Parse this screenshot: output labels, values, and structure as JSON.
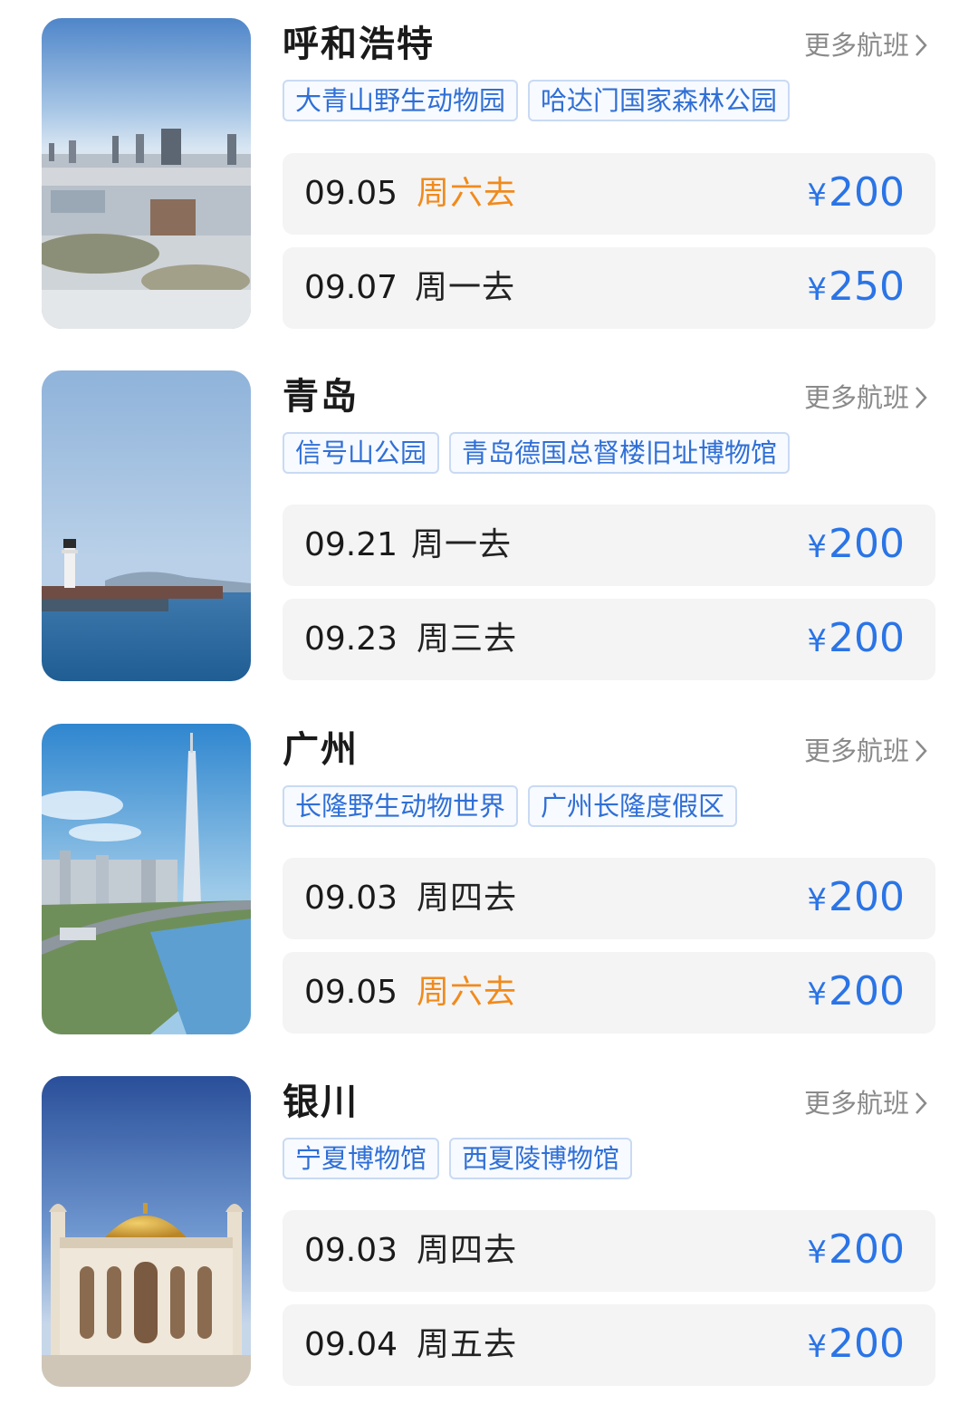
{
  "more_label": "更多航班",
  "colors": {
    "price": "#2a74e6",
    "weekend": "#f18a1c",
    "tag_text": "#2f6fd6"
  },
  "destinations": [
    {
      "city": "呼和浩特",
      "photo_icon": "city-skyline-photo",
      "tags": [
        "大青山野生动物园",
        "哈达门国家森林公园"
      ],
      "flights": [
        {
          "date": "09.05",
          "day": "周六去",
          "currency": "¥",
          "price": "200",
          "weekend": true
        },
        {
          "date": "09.07",
          "day": "周一去",
          "currency": "¥",
          "price": "250",
          "weekend": false
        }
      ]
    },
    {
      "city": "青岛",
      "photo_icon": "lighthouse-sea-photo",
      "tags": [
        "信号山公园",
        "青岛德国总督楼旧址博物馆"
      ],
      "flights": [
        {
          "date": "09.21",
          "day": "周一去",
          "currency": "¥",
          "price": "200",
          "weekend": false
        },
        {
          "date": "09.23",
          "day": "周三去",
          "currency": "¥",
          "price": "200",
          "weekend": false
        }
      ]
    },
    {
      "city": "广州",
      "photo_icon": "canton-tower-photo",
      "tags": [
        "长隆野生动物世界",
        "广州长隆度假区"
      ],
      "flights": [
        {
          "date": "09.03",
          "day": "周四去",
          "currency": "¥",
          "price": "200",
          "weekend": false
        },
        {
          "date": "09.05",
          "day": "周六去",
          "currency": "¥",
          "price": "200",
          "weekend": true
        }
      ]
    },
    {
      "city": "银川",
      "photo_icon": "mosque-dome-photo",
      "tags": [
        "宁夏博物馆",
        "西夏陵博物馆"
      ],
      "flights": [
        {
          "date": "09.03",
          "day": "周四去",
          "currency": "¥",
          "price": "200",
          "weekend": false
        },
        {
          "date": "09.04",
          "day": "周五去",
          "currency": "¥",
          "price": "200",
          "weekend": false
        }
      ]
    }
  ]
}
